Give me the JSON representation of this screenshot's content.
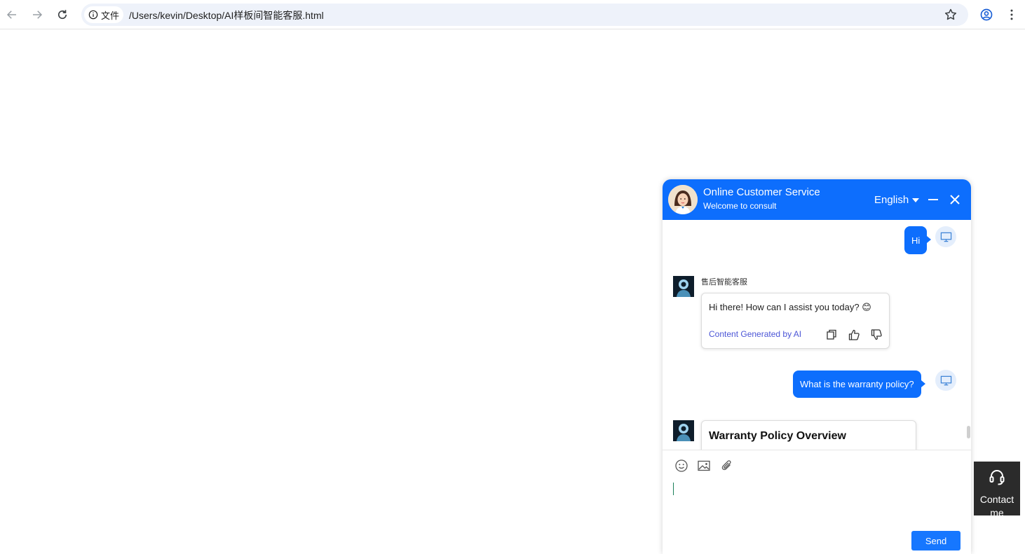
{
  "browser": {
    "site_info_label": "文件",
    "url": "/Users/kevin/Desktop/AI样板间智能客服.html"
  },
  "chat": {
    "title": "Online Customer Service",
    "subtitle": "Welcome to consult",
    "language": "English",
    "messages": [
      {
        "role": "user",
        "text": "Hi"
      },
      {
        "role": "bot",
        "sender": "售后智能客服",
        "text": "Hi there! How can I assist you today? 😊",
        "note": "Content Generated by AI"
      },
      {
        "role": "user",
        "text": "What is the warranty policy?"
      },
      {
        "role": "bot",
        "title": "Warranty Policy Overview"
      }
    ],
    "send_label": "Send"
  },
  "contact": {
    "label": "Contact me"
  },
  "colors": {
    "primary": "#0d6efd",
    "send": "#1677ff",
    "ai_note": "#4b55d6",
    "contact_bg": "#2b2b2b"
  },
  "icons": [
    "back-arrow-icon",
    "forward-arrow-icon",
    "reload-icon",
    "info-icon",
    "star-icon",
    "profile-icon",
    "menu-dots-icon",
    "minimize-icon",
    "close-icon",
    "monitor-icon",
    "copy-icon",
    "thumbs-up-icon",
    "thumbs-down-icon",
    "emoji-icon",
    "image-icon",
    "paperclip-icon",
    "headset-icon"
  ]
}
